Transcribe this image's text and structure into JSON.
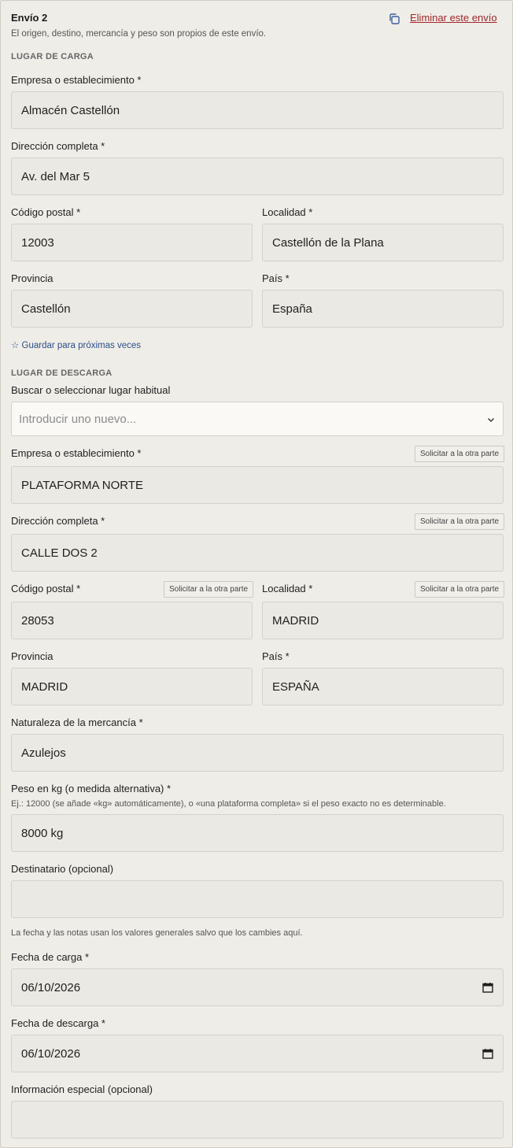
{
  "header": {
    "title": "Envío 2",
    "subtitle": "El origen, destino, mercancía y peso son propios de este envío.",
    "delete_label": "Eliminar este envío",
    "copy_icon": "copy-icon"
  },
  "load": {
    "section_title": "LUGAR DE CARGA",
    "company_label": "Empresa o establecimiento *",
    "company_value": "Almacén Castellón",
    "address_label": "Dirección completa *",
    "address_value": "Av. del Mar 5",
    "postal_label": "Código postal *",
    "postal_value": "12003",
    "city_label": "Localidad *",
    "city_value": "Castellón de la Plana",
    "province_label": "Provincia",
    "province_value": "Castellón",
    "country_label": "País *",
    "country_value": "España",
    "save_label": "☆ Guardar para próximas veces"
  },
  "unload": {
    "section_title": "LUGAR DE DESCARGA",
    "search_label": "Buscar o seleccionar lugar habitual",
    "search_placeholder": "Introducir uno nuevo...",
    "request_label": "Solicitar a la otra parte",
    "company_label": "Empresa o establecimiento *",
    "company_value": "PLATAFORMA NORTE",
    "address_label": "Dirección completa *",
    "address_value": "CALLE DOS 2",
    "postal_label": "Código postal *",
    "postal_value": "28053",
    "city_label": "Localidad *",
    "city_value": "MADRID",
    "province_label": "Provincia",
    "province_value": "MADRID",
    "country_label": "País *",
    "country_value": "ESPAÑA"
  },
  "goods": {
    "nature_label": "Naturaleza de la mercancía *",
    "nature_value": "Azulejos",
    "weight_label": "Peso en kg (o medida alternativa) *",
    "weight_hint": "Ej.: 12000 (se añade «kg» automáticamente), o «una plataforma completa» si el peso exacto no es determinable.",
    "weight_value": "8000 kg",
    "recipient_label": "Destinatario (opcional)",
    "recipient_value": ""
  },
  "dates": {
    "note": "La fecha y las notas usan los valores generales salvo que los cambies aquí.",
    "load_date_label": "Fecha de carga *",
    "load_date_value": "06/10/2026",
    "unload_date_label": "Fecha de descarga *",
    "unload_date_value": "06/10/2026",
    "special_label": "Información especial (opcional)",
    "special_value": "",
    "calendar_icon": "calendar-icon"
  }
}
